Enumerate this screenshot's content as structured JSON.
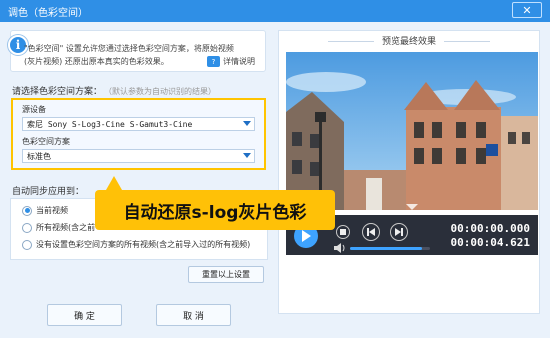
{
  "window": {
    "title": "调色（色彩空间）",
    "close_glyph": "✕"
  },
  "info": {
    "line1": "\"色彩空间\" 设置允许您通过选择色彩空间方案，将原始视频",
    "line2": "(灰片视频) 还原出原本真实的色彩效果。",
    "help_label": "详情说明",
    "help_icon_text": "?"
  },
  "scheme": {
    "label": "请选择色彩空间方案：",
    "hint": "（默认参数为自动识别的结果）",
    "device_label": "源设备",
    "device_value": "索尼 Sony S-Log3-Cine S-Gamut3-Cine",
    "space_label": "色彩空间方案",
    "space_value": "标准色"
  },
  "sync": {
    "label": "自动同步应用到：",
    "options": [
      "当前视频",
      "所有视频(含之前",
      "没有设置色彩空间方案的所有视频(含之前导入过的所有视频)"
    ],
    "selected_index": 0
  },
  "buttons": {
    "reset": "重置以上设置",
    "ok": "确 定",
    "cancel": "取 消"
  },
  "preview": {
    "title": "预览最终效果",
    "time_current": "00:00:00.000",
    "time_total": "00:00:04.621",
    "progress_fraction": 0.0,
    "volume_fraction": 0.9
  },
  "overlay": {
    "caption": "自动还原s-log灰片色彩"
  },
  "colors": {
    "accent": "#2f8fe6",
    "highlight": "#ffc107"
  }
}
